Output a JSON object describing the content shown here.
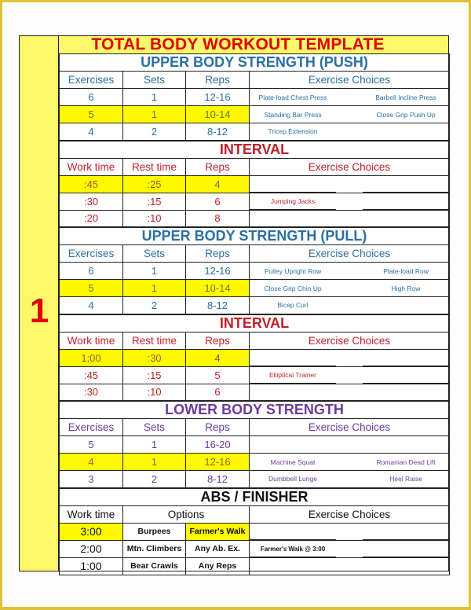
{
  "title": "TOTAL BODY WORKOUT TEMPLATE",
  "page_number": "1",
  "colors": {
    "frame": "#e0c23a",
    "highlight": "#fdfa00",
    "side_bar": "#fdf86b",
    "title": "#e00000",
    "strength_blue": "#2b6fa3",
    "interval_red": "#c0202a",
    "lower_purple": "#6e3a9a"
  },
  "sections": [
    {
      "title": "UPPER BODY STRENGTH (PUSH)",
      "headers": [
        "Exercises",
        "Sets",
        "Reps",
        "Exercise Choices"
      ],
      "rows": [
        {
          "c1": "6",
          "c2": "1",
          "c3": "12-16",
          "left": "Plate-load Chest Press",
          "right": "Barbell Incline Press",
          "highlight": false
        },
        {
          "c1": "5",
          "c2": "1",
          "c3": "10-14",
          "left": "Standing Bar Press",
          "right": "Close Grip Push Up",
          "highlight": true
        },
        {
          "c1": "4",
          "c2": "2",
          "c3": "8-12",
          "left": "Tricep Extension",
          "right": "",
          "highlight": false
        }
      ]
    },
    {
      "title": "INTERVAL",
      "headers": [
        "Work time",
        "Rest time",
        "Reps",
        "Exercise Choices"
      ],
      "rows": [
        {
          "c1": ":45",
          "c2": ":25",
          "c3": "4",
          "left": "",
          "right": "",
          "highlight": true
        },
        {
          "c1": ":30",
          "c2": ":15",
          "c3": "6",
          "left": "Jumping Jacks",
          "right": "",
          "highlight": false
        },
        {
          "c1": ":20",
          "c2": ":10",
          "c3": "8",
          "left": "",
          "right": "",
          "highlight": false
        }
      ]
    },
    {
      "title": "UPPER BODY STRENGTH (PULL)",
      "headers": [
        "Exercises",
        "Sets",
        "Reps",
        "Exercise Choices"
      ],
      "rows": [
        {
          "c1": "6",
          "c2": "1",
          "c3": "12-16",
          "left": "Pulley Upright Row",
          "right": "Plate-load Row",
          "highlight": false
        },
        {
          "c1": "5",
          "c2": "1",
          "c3": "10-14",
          "left": "Close Grip Chin Up",
          "right": "High Row",
          "highlight": true
        },
        {
          "c1": "4",
          "c2": "2",
          "c3": "8-12",
          "left": "Bicep Curl",
          "right": "",
          "highlight": false
        }
      ]
    },
    {
      "title": "INTERVAL",
      "headers": [
        "Work time",
        "Rest time",
        "Reps",
        "Exercise Choices"
      ],
      "rows": [
        {
          "c1": "1:00",
          "c2": ":30",
          "c3": "4",
          "left": "",
          "right": "",
          "highlight": true
        },
        {
          "c1": ":45",
          "c2": ":15",
          "c3": "5",
          "left": "Elliptical Trainer",
          "right": "",
          "highlight": false
        },
        {
          "c1": ":30",
          "c2": ":10",
          "c3": "6",
          "left": "",
          "right": "",
          "highlight": false
        }
      ]
    },
    {
      "title": "LOWER BODY STRENGTH",
      "headers": [
        "Exercises",
        "Sets",
        "Reps",
        "Exercise Choices"
      ],
      "rows": [
        {
          "c1": "5",
          "c2": "1",
          "c3": "16-20",
          "left": "",
          "right": "",
          "highlight": false
        },
        {
          "c1": "4",
          "c2": "1",
          "c3": "12-16",
          "left": "Machine Squat",
          "right": "Romanian Dead Lift",
          "highlight": true
        },
        {
          "c1": "3",
          "c2": "2",
          "c3": "8-12",
          "left": "Dumbbell Lunge",
          "right": "Heel Raise",
          "highlight": false
        }
      ]
    },
    {
      "title": "ABS / FINISHER",
      "headers": [
        "Work time",
        "Options",
        "Exercise Choices"
      ],
      "rows": [
        {
          "c1": "3:00",
          "c2": "Burpees",
          "c3": "Farmer's Walk",
          "left": "",
          "right": "",
          "highlight": true
        },
        {
          "c1": "2:00",
          "c2": "Mtn. Climbers",
          "c3": "Any Ab. Ex.",
          "left": "Farmer's Walk @ 3:00",
          "right": "",
          "highlight": false
        },
        {
          "c1": "1:00",
          "c2": "Bear Crawls",
          "c3": "Any Reps",
          "left": "",
          "right": "",
          "highlight": false
        }
      ]
    }
  ]
}
